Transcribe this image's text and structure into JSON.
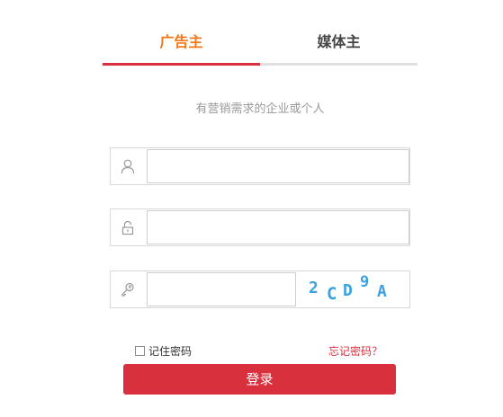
{
  "tabs": [
    {
      "label": "广告主",
      "active": true
    },
    {
      "label": "媒体主",
      "active": false
    }
  ],
  "subtitle": "有营销需求的企业或个人",
  "username": {
    "value": "",
    "placeholder": "",
    "icon": "user-icon"
  },
  "password": {
    "value": "",
    "placeholder": "",
    "icon": "lock-icon"
  },
  "captcha": {
    "value": "",
    "placeholder": "",
    "icon": "key-icon",
    "code": [
      "2",
      "C",
      "D",
      "9",
      "A"
    ]
  },
  "remember_label": "记住密码",
  "forgot_label": "忘记密码？",
  "login_label": "登录",
  "colors": {
    "accent": "#d9303e",
    "tab_active_text": "#f07818",
    "captcha_text": "#3aa3df"
  }
}
